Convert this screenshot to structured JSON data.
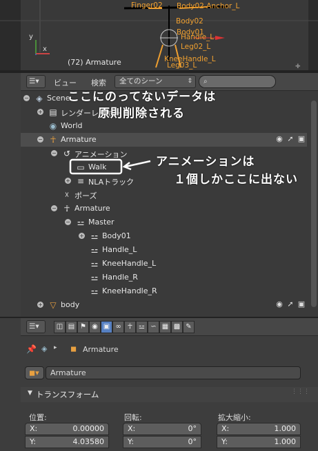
{
  "viewport": {
    "status_text": "(72) Armature",
    "axis_y": "y",
    "axis_x": "x",
    "bone_labels": [
      "Finger02",
      "Body02 Anchor_L",
      "Body02",
      "Body01",
      "Handle_L",
      "Leg02_L",
      "KneeHandle_L",
      "Leg03_L"
    ]
  },
  "outliner": {
    "view_menu": "ビュー",
    "search_menu": "検索",
    "scene_filter": "全てのシーン",
    "search_placeholder": "",
    "rows": [
      {
        "label": "Scene",
        "icon": "scene-icon",
        "indent": 0,
        "exp": "−"
      },
      {
        "label": "レンダーレイヤー",
        "icon": "render-layers-icon",
        "indent": 1,
        "exp": "+"
      },
      {
        "label": "World",
        "icon": "world-icon",
        "indent": 1,
        "exp": ""
      },
      {
        "label": "Armature",
        "icon": "armature-object-icon",
        "indent": 1,
        "exp": "−",
        "selected": true
      },
      {
        "label": "アニメーション",
        "icon": "animation-icon",
        "indent": 2,
        "exp": "−"
      },
      {
        "label": "Walk",
        "icon": "action-icon",
        "indent": 3,
        "exp": ""
      },
      {
        "label": "NLAトラック",
        "icon": "nla-icon",
        "indent": 3,
        "exp": "+"
      },
      {
        "label": "ポーズ",
        "icon": "pose-icon",
        "indent": 2,
        "exp": ""
      },
      {
        "label": "Armature",
        "icon": "armature-data-icon",
        "indent": 2,
        "exp": "−"
      },
      {
        "label": "Master",
        "icon": "bone-icon",
        "indent": 3,
        "exp": "−"
      },
      {
        "label": "Body01",
        "icon": "bone-icon",
        "indent": 4,
        "exp": "+"
      },
      {
        "label": "Handle_L",
        "icon": "bone-icon",
        "indent": 4,
        "exp": ""
      },
      {
        "label": "KneeHandle_L",
        "icon": "bone-icon",
        "indent": 4,
        "exp": ""
      },
      {
        "label": "Handle_R",
        "icon": "bone-icon",
        "indent": 4,
        "exp": ""
      },
      {
        "label": "KneeHandle_R",
        "icon": "bone-icon",
        "indent": 4,
        "exp": ""
      },
      {
        "label": "body",
        "icon": "mesh-object-icon",
        "indent": 1,
        "exp": "+"
      }
    ],
    "annotations": {
      "top": "ここにのってないデータは",
      "top2": "原則削除される",
      "right": "アニメーションは",
      "right2": "１個しかここに出ない"
    }
  },
  "properties": {
    "breadcrumb_object": "Armature",
    "object_name": "Armature",
    "panel_title": "トランスフォーム",
    "location_label": "位置:",
    "rotation_label": "回転:",
    "scale_label": "拡大縮小:",
    "location": [
      {
        "k": "X:",
        "v": "0.00000"
      },
      {
        "k": "Y:",
        "v": "4.03580"
      }
    ],
    "rotation": [
      {
        "k": "X:",
        "v": "0°"
      },
      {
        "k": "Y:",
        "v": "0°"
      }
    ],
    "scale": [
      {
        "k": "X:",
        "v": "1.000"
      },
      {
        "k": "Y:",
        "v": "1.000"
      }
    ]
  },
  "colors": {
    "accent": "#5680c2",
    "bone_orange": "#f0a030",
    "selected_row": "#4d4d4d"
  }
}
